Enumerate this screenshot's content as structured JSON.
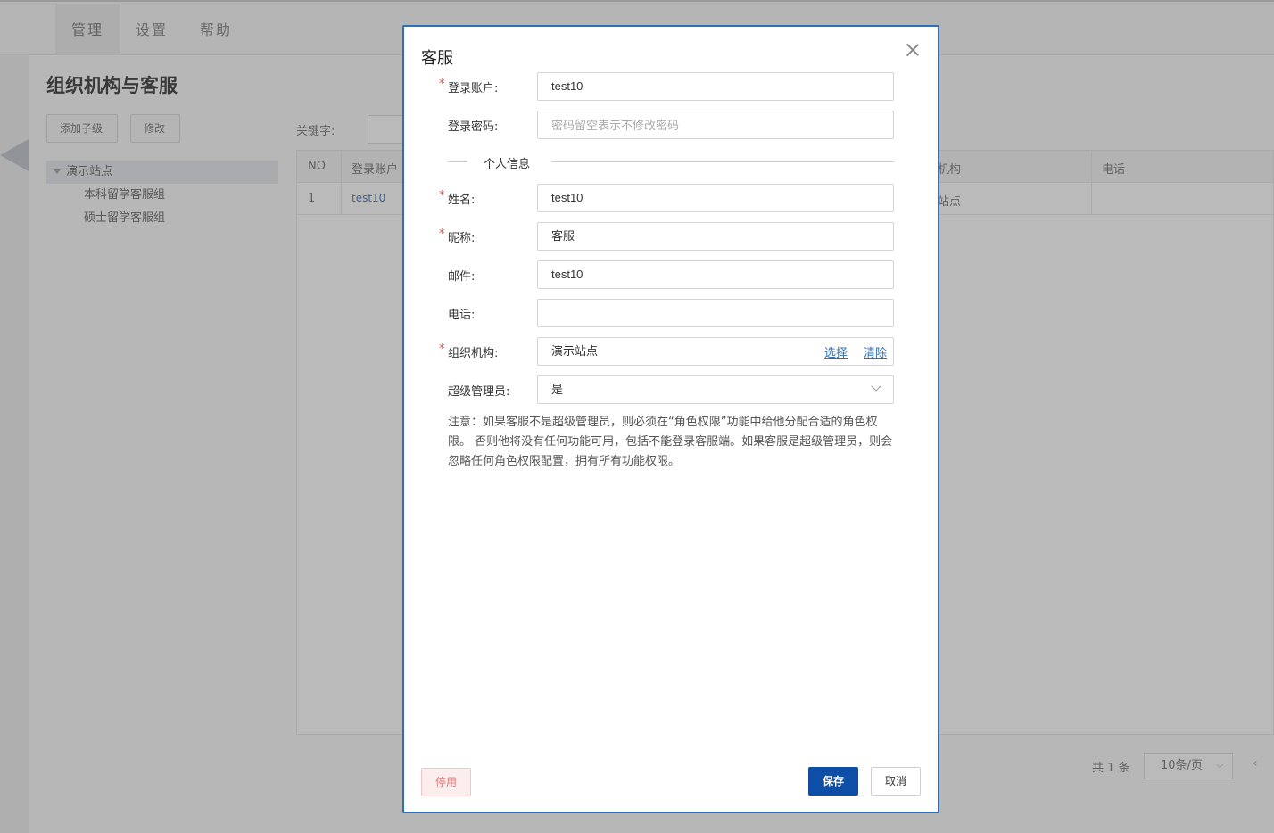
{
  "app": {
    "nav": [
      "管理",
      "设置",
      "帮助"
    ],
    "page_title": "组织机构与客服",
    "toolbar": {
      "add_child": "添加子级",
      "edit": "修改",
      "keyword_label": "关键字:"
    },
    "tree": {
      "root": "演示站点",
      "children": [
        "本科留学客服组",
        "硕士留学客服组"
      ]
    },
    "table": {
      "headers": {
        "no": "NO",
        "account": "登录账户",
        "org": "机构",
        "phone": "电话"
      },
      "rows": [
        {
          "no": "1",
          "account": "test10",
          "org": "站点",
          "phone": ""
        }
      ]
    },
    "pager": {
      "total": "共 1 条",
      "page_size": "10条/页",
      "prev": "‹"
    }
  },
  "dialog": {
    "title": "客服",
    "close": "×",
    "fields": {
      "account": {
        "label": "登录账户:",
        "value": "test10",
        "required": "*"
      },
      "password": {
        "label": "登录密码:",
        "placeholder": "密码留空表示不修改密码"
      },
      "section": "个人信息",
      "name": {
        "label": "姓名:",
        "value": "test10",
        "required": "*"
      },
      "nickname": {
        "label": "昵称:",
        "value": "客服",
        "required": "*"
      },
      "email": {
        "label": "邮件:",
        "value": "test10"
      },
      "phone": {
        "label": "电话:",
        "value": ""
      },
      "org": {
        "label": "组织机构:",
        "value": "演示站点",
        "required": "*",
        "select": "选择",
        "clear": "清除"
      },
      "super_admin": {
        "label": "超级管理员:",
        "value": "是"
      }
    },
    "note": "注意：如果客服不是超级管理员，则必须在“角色权限”功能中给他分配合适的角色权限。 否则他将没有任何功能可用，包括不能登录客服端。如果客服是超级管理员，则会忽略任何角色权限配置，拥有所有功能权限。",
    "buttons": {
      "disable": "停用",
      "save": "保存",
      "cancel": "取消"
    }
  },
  "colors": {
    "primary": "#0f4ea6",
    "link": "#2f6fb5",
    "required": "#e34b4b",
    "danger": "#e27878"
  }
}
